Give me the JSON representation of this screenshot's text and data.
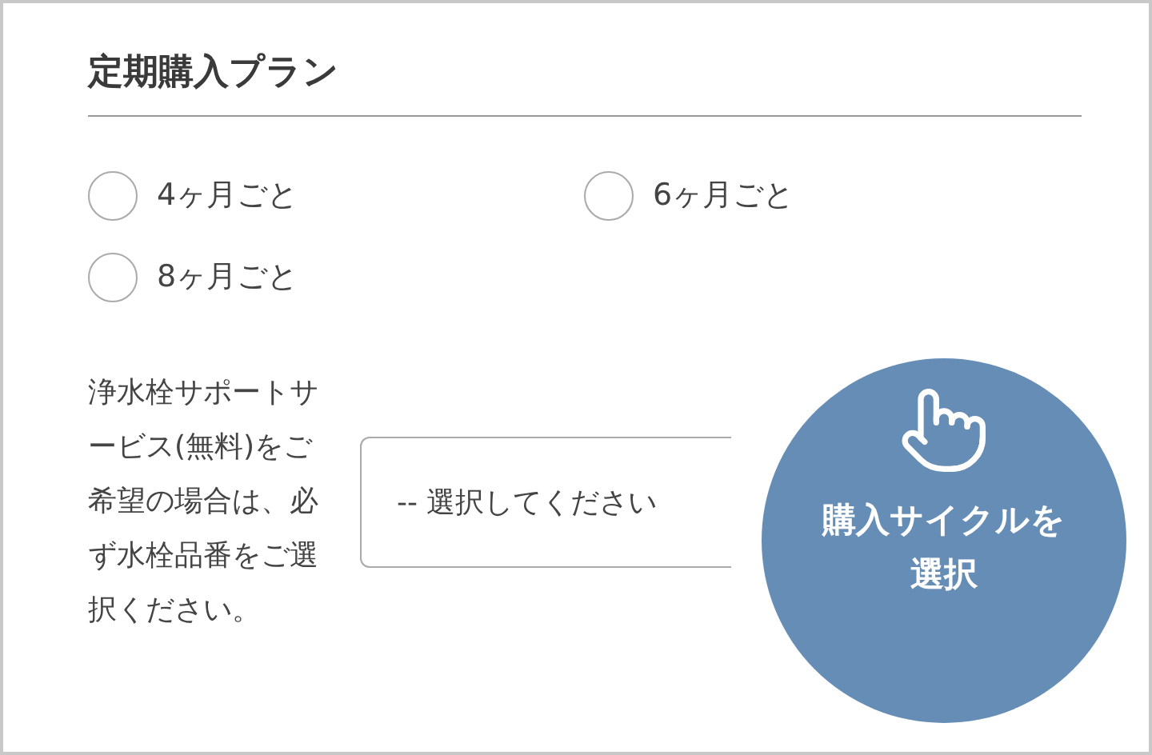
{
  "section": {
    "title": "定期購入プラン"
  },
  "plans": [
    {
      "label": "4ヶ月ごと",
      "selected": false
    },
    {
      "label": "6ヶ月ごと",
      "selected": false
    },
    {
      "label": "8ヶ月ごと",
      "selected": false
    }
  ],
  "support": {
    "note": "浄水栓サポートサービス(無料)をご希望の場合は、必ず水栓品番をご選択ください。",
    "select_value": "-- 選択してください"
  },
  "callout": {
    "text": "購入サイクルを選択"
  }
}
